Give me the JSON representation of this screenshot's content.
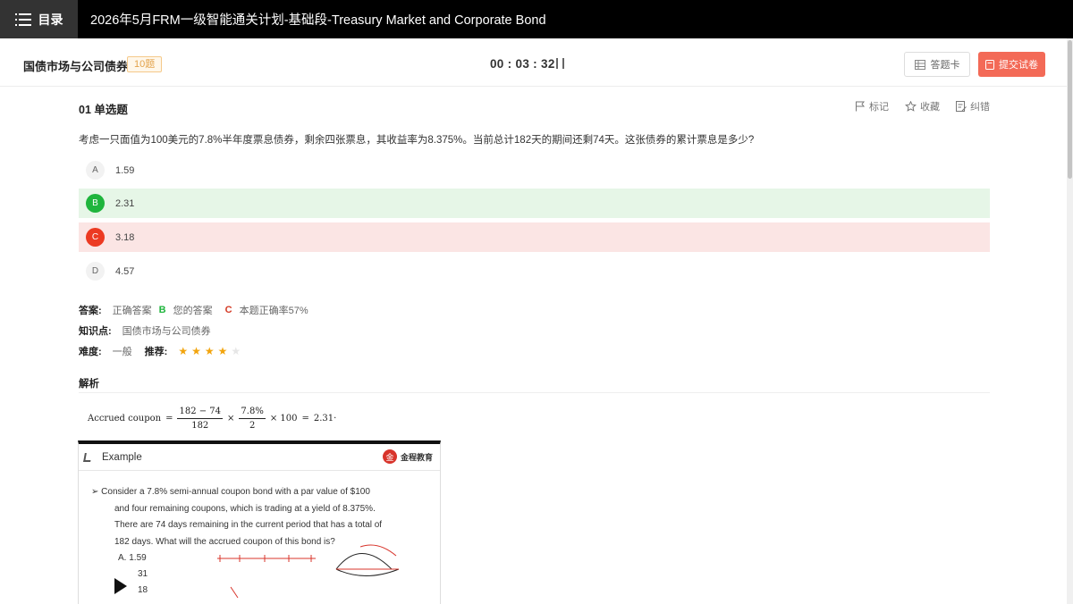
{
  "topbar": {
    "toc_label": "目录",
    "title": "2026年5月FRM一级智能通关计划-基础段-Treasury Market and Corporate Bond"
  },
  "subheader": {
    "section_name": "国债市场与公司债券",
    "count_badge": "10题",
    "timer": "00 : 03 : 32",
    "answer_card_label": "答题卡",
    "submit_label": "提交试卷"
  },
  "question": {
    "header": "01 单选题",
    "actions": {
      "mark": "标记",
      "favorite": "收藏",
      "report": "纠错"
    },
    "text": "考虑一只面值为100美元的7.8%半年度票息债券，剩余四张票息，其收益率为8.375%。当前总计182天的期间还剩74天。这张债券的累计票息是多少?",
    "options": [
      {
        "letter": "A",
        "text": "1.59",
        "state": "normal"
      },
      {
        "letter": "B",
        "text": "2.31",
        "state": "correct"
      },
      {
        "letter": "C",
        "text": "3.18",
        "state": "wrong"
      },
      {
        "letter": "D",
        "text": "4.57",
        "state": "normal"
      }
    ]
  },
  "result": {
    "answer_label": "答案:",
    "correct_label": "正确答案",
    "correct_letter": "B",
    "your_label": "您的答案",
    "your_letter": "C",
    "rate_text": "本题正确率57%",
    "knowledge_label": "知识点:",
    "knowledge_value": "国债市场与公司债券",
    "difficulty_label": "难度:",
    "difficulty_value": "一般",
    "recommend_label": "推荐:",
    "recommend_rating": 4,
    "recommend_max": 5
  },
  "analysis": {
    "title": "解析",
    "formula": {
      "lhs": "Accrued coupon",
      "eq": "=",
      "f1_num": "182 − 74",
      "f1_den": "182",
      "times1": "×",
      "f2_num": "7.8%",
      "f2_den": "2",
      "times2": "× 100",
      "eq2": "=",
      "result": "2.31·"
    }
  },
  "example": {
    "title": "Example",
    "logo_text": "金程教育",
    "lines": [
      "➢  Consider a 7.8% semi-annual coupon bond with a par value of $100",
      "and four remaining coupons, which is trading at a yield of 8.375%.",
      "There are 74 days remaining in the current period that has a total of",
      "182 days. What will the accrued coupon of this bond is?"
    ],
    "options": [
      "A. 1.59",
      "31",
      "18"
    ]
  },
  "colors": {
    "accent_submit": "#f36a57",
    "correct_green": "#1fb53d",
    "wrong_red": "#ec3a22",
    "star": "#f2a40d"
  }
}
